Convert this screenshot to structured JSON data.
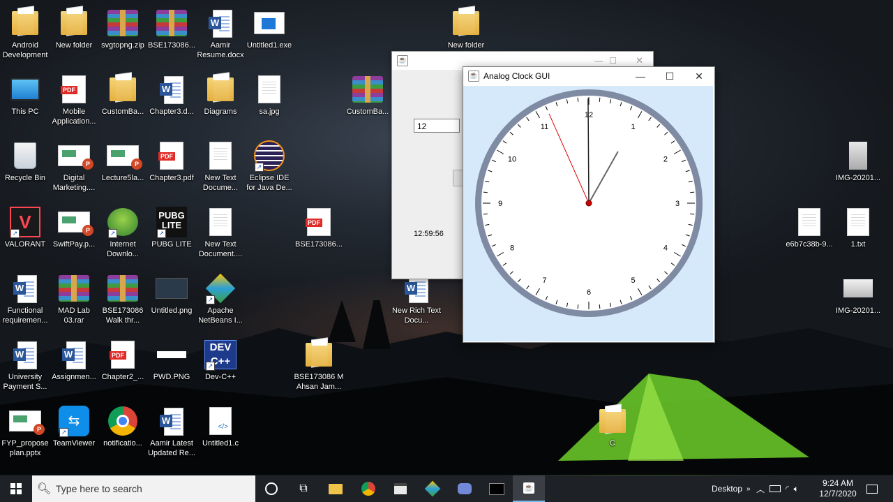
{
  "desktop": {
    "icons": [
      {
        "label": "Android Development",
        "type": "folder"
      },
      {
        "label": "New folder",
        "type": "folder"
      },
      {
        "label": "svgtopng.zip",
        "type": "rar"
      },
      {
        "label": "BSE173086...",
        "type": "rar"
      },
      {
        "label": "Aamir Resume.docx",
        "type": "word"
      },
      {
        "label": "Untitled1.exe",
        "type": "exe"
      },
      {
        "label": "This PC",
        "type": "pc"
      },
      {
        "label": "Mobile Application...",
        "type": "pdf"
      },
      {
        "label": "CustomBa...",
        "type": "folder"
      },
      {
        "label": "Chapter3.d...",
        "type": "word"
      },
      {
        "label": "Diagrams",
        "type": "folder"
      },
      {
        "label": "sa.jpg",
        "type": "doc"
      },
      {
        "label": "Recycle Bin",
        "type": "bin"
      },
      {
        "label": "Digital Marketing....",
        "type": "ppt"
      },
      {
        "label": "Lecture5la...",
        "type": "ppt"
      },
      {
        "label": "Chapter3.pdf",
        "type": "pdf"
      },
      {
        "label": "New Text Docume...",
        "type": "doc"
      },
      {
        "label": "Eclipse IDE for Java De...",
        "type": "eclipse"
      },
      {
        "label": "VALORANT",
        "type": "valorant"
      },
      {
        "label": "SwiftPay.p...",
        "type": "ppt"
      },
      {
        "label": "Internet Downlo...",
        "type": "idm"
      },
      {
        "label": "PUBG LITE",
        "type": "pubg"
      },
      {
        "label": "New Text Document....",
        "type": "doc"
      },
      {
        "label": "Functional requiremen...",
        "type": "word"
      },
      {
        "label": "MAD Lab 03.rar",
        "type": "rar"
      },
      {
        "label": "BSE173086 Walk thr...",
        "type": "rar"
      },
      {
        "label": "Untitled.png",
        "type": "png-black"
      },
      {
        "label": "Apache NetBeans I...",
        "type": "netbeans"
      },
      {
        "label": "University Payment S...",
        "type": "word"
      },
      {
        "label": "Assignmen...",
        "type": "word"
      },
      {
        "label": "Chapter2_...",
        "type": "pdf"
      },
      {
        "label": "PWD.PNG",
        "type": "png-white"
      },
      {
        "label": "Dev-C++",
        "type": "devc"
      },
      {
        "label": "FYP_propose plan.pptx",
        "type": "ppt"
      },
      {
        "label": "TeamViewer",
        "type": "teamviewer"
      },
      {
        "label": "notificatio...",
        "type": "chrome"
      },
      {
        "label": "Aamir Latest Updated Re...",
        "type": "word"
      },
      {
        "label": "Untitled1.c",
        "type": "cfile"
      },
      {
        "label": "New folder",
        "type": "folder"
      },
      {
        "label": "CustomBa...",
        "type": "rar"
      },
      {
        "label": "BSE173086...",
        "type": "pdf"
      },
      {
        "label": "New Rich Text Docu...",
        "type": "word"
      },
      {
        "label": "BSE173086 M Ahsan Jam...",
        "type": "folder"
      },
      {
        "label": "C",
        "type": "folder"
      },
      {
        "label": "IMG-20201...",
        "type": "img-thumb"
      },
      {
        "label": "e6b7c38b-9...",
        "type": "doc"
      },
      {
        "label": "1.txt",
        "type": "doc"
      },
      {
        "label": "IMG-20201...",
        "type": "img-wide"
      }
    ]
  },
  "back_window": {
    "text_field_value": "12",
    "digital_time": "12:59:56"
  },
  "clock_window": {
    "title": "Analog Clock GUI",
    "minimize": "—",
    "maximize": "☐",
    "close": "✕",
    "numbers": [
      "12",
      "1",
      "2",
      "3",
      "4",
      "5",
      "6",
      "7",
      "8",
      "9",
      "10",
      "11"
    ],
    "time": {
      "hours": 12,
      "minutes": 59,
      "seconds": 56
    }
  },
  "taskbar": {
    "search_placeholder": "Type here to search",
    "desktop_label": "Desktop",
    "time": "9:24 AM",
    "date": "12/7/2020"
  }
}
